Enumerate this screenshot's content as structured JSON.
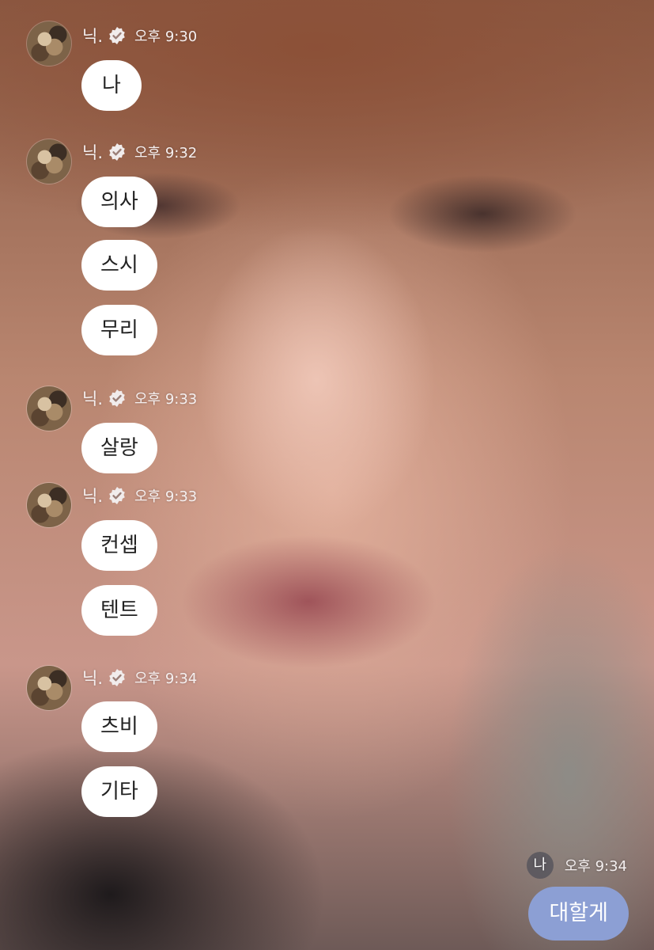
{
  "chat": {
    "sender_name": "닉.",
    "groups": [
      {
        "time": "오후 9:30",
        "messages": [
          "나"
        ]
      },
      {
        "time": "오후 9:32",
        "messages": [
          "의사",
          "스시",
          "무리"
        ]
      },
      {
        "time": "오후 9:33",
        "messages": [
          "살랑"
        ]
      },
      {
        "time": "오후 9:33",
        "messages": [
          "컨셉",
          "텐트"
        ]
      },
      {
        "time": "오후 9:34",
        "messages": [
          "츠비",
          "기타"
        ]
      }
    ],
    "my_message": {
      "avatar_label": "나",
      "time": "오후 9:34",
      "text": "대할게"
    }
  },
  "colors": {
    "bubble_in": "#ffffff",
    "bubble_out": "#8c9fd4",
    "text_dark": "#222222"
  },
  "icons": [
    "profile-avatar",
    "verified-badge-icon"
  ]
}
